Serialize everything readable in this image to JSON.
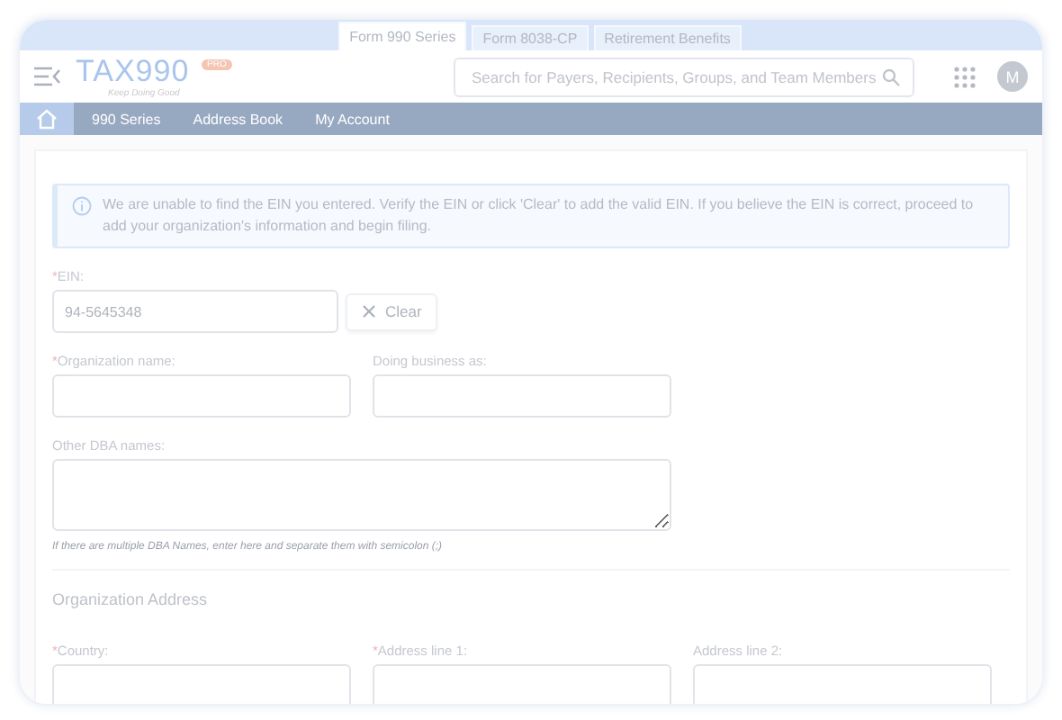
{
  "top_tabs": [
    {
      "label": "Form 990 Series",
      "selected": true
    },
    {
      "label": "Form 8038-CP",
      "selected": false
    },
    {
      "label": "Retirement Benefits",
      "selected": false
    }
  ],
  "header": {
    "logo": "TAX990",
    "logo_badge": "PRO",
    "tagline": "Keep Doing Good",
    "search": {
      "placeholder": "Search for Payers, Recipients, Groups, and Team Members"
    },
    "avatar": "M"
  },
  "nav": [
    {
      "label": "990 Series"
    },
    {
      "label": "Address Book"
    },
    {
      "label": "My Account"
    }
  ],
  "notice": "We are unable to find the EIN you entered. Verify the EIN or click 'Clear' to add the valid EIN. If you believe the EIN is correct, proceed to add your organization's information and begin filing.",
  "ein": {
    "mark": "*",
    "label": "EIN:",
    "value": "94-5645348",
    "clear": "Clear"
  },
  "org_name": {
    "mark": "*",
    "label": "Organization name:"
  },
  "dba": {
    "label": "Doing business as:"
  },
  "other_dba": {
    "label": "Other DBA names:",
    "hint": "If there are multiple DBA Names, enter here and separate them with semicolon (;)"
  },
  "address_title": "Organization Address",
  "address_fields": [
    {
      "mark": "*",
      "label": "Country:"
    },
    {
      "mark": "*",
      "label": "Address line 1:"
    },
    {
      "label": "Address line 2:"
    }
  ]
}
